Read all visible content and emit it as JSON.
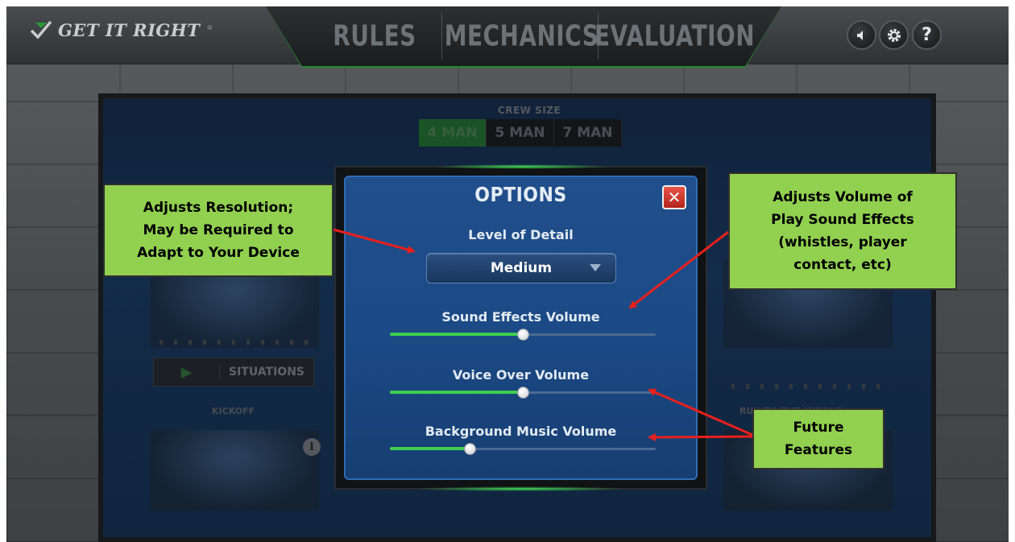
{
  "app": {
    "logo_text": "GET IT RIGHT",
    "logo_reg": "®"
  },
  "nav": {
    "tabs": [
      "RULES",
      "MECHANICS",
      "EVALUATION"
    ]
  },
  "header_buttons": {
    "sound": "sound-icon",
    "settings": "gear-icon",
    "help": "?"
  },
  "board": {
    "crew_title": "CREW SIZE",
    "crew_options": [
      "4 MAN",
      "5 MAN",
      "7 MAN"
    ],
    "crew_selected": "4 MAN",
    "situations_label": "SITUATIONS",
    "kickoff_label": "KICKOFF",
    "right_label": "RUN TO THE MIDDLE",
    "info_icon": "i"
  },
  "dialog": {
    "title": "OPTIONS",
    "close": "✕",
    "detail_label": "Level of Detail",
    "detail_value": "Medium",
    "sliders": [
      {
        "label": "Sound Effects Volume",
        "value": 0.5
      },
      {
        "label": "Voice Over Volume",
        "value": 0.5
      },
      {
        "label": "Background Music Volume",
        "value": 0.3
      }
    ]
  },
  "callouts": {
    "resolution": "Adjusts Resolution;\nMay be Required to\nAdapt to Your Device",
    "volume": "Adjusts Volume of\nPlay Sound Effects\n(whistles, player\ncontact, etc)",
    "future": "Future\nFeatures"
  },
  "colors": {
    "accent_green": "#92d050",
    "arrow_red": "#e8201c",
    "slider_green": "#3fce4e",
    "dialog_blue": "#1b4a86"
  }
}
